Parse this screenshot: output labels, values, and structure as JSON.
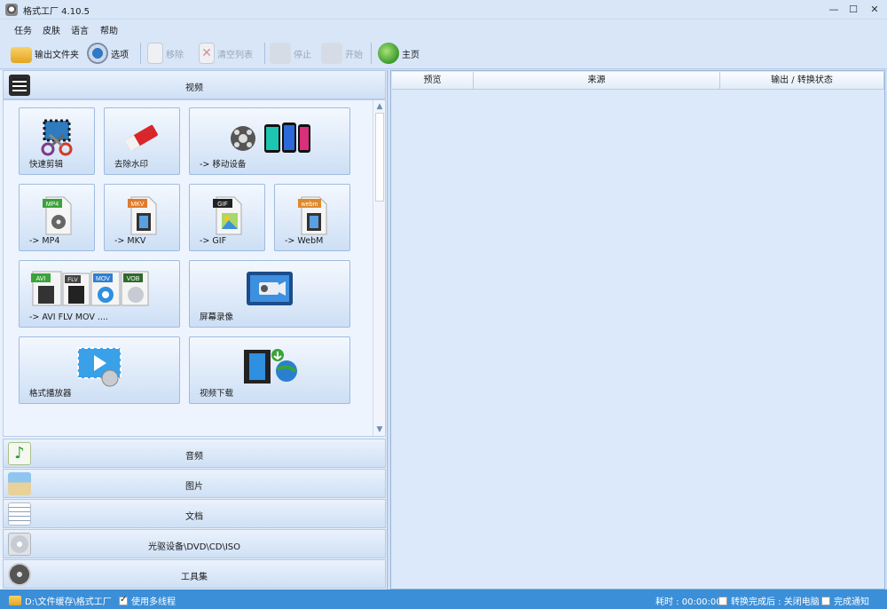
{
  "window": {
    "title": "格式工厂 4.10.5",
    "controls": [
      "—",
      "☐",
      "✕"
    ]
  },
  "menu": [
    "任务",
    "皮肤",
    "语言",
    "帮助"
  ],
  "toolbar": [
    {
      "label": "输出文件夹",
      "icon": "folder-icon",
      "enabled": true
    },
    {
      "label": "选项",
      "icon": "options-gear-icon",
      "enabled": true
    },
    {
      "label": "移除",
      "icon": "remove-icon",
      "enabled": false
    },
    {
      "label": "清空列表",
      "icon": "clear-list-icon",
      "enabled": false
    },
    {
      "label": "停止",
      "icon": "stop-icon",
      "enabled": false
    },
    {
      "label": "开始",
      "icon": "start-icon",
      "enabled": false
    },
    {
      "label": "主页",
      "icon": "home-globe-icon",
      "enabled": true
    }
  ],
  "categories": {
    "video": "视频",
    "audio": "音频",
    "image": "图片",
    "document": "文档",
    "disc": "光驱设备\\DVD\\CD\\ISO",
    "tools": "工具集"
  },
  "video_tiles": [
    {
      "label": "快速剪辑",
      "icon": "quick-clip-icon"
    },
    {
      "label": "去除水印",
      "icon": "remove-watermark-icon"
    },
    {
      "label": "-> 移动设备",
      "icon": "mobile-device-icon"
    },
    {
      "label": "-> MP4",
      "icon": "mp4-file-icon",
      "badge": "MP4"
    },
    {
      "label": "-> MKV",
      "icon": "mkv-file-icon",
      "badge": "MKV"
    },
    {
      "label": "-> GIF",
      "icon": "gif-file-icon",
      "badge": "GIF"
    },
    {
      "label": "-> WebM",
      "icon": "webm-file-icon",
      "badge": "webm"
    },
    {
      "label": "-> AVI FLV MOV ....",
      "icon": "multi-format-icon",
      "badges": [
        "AVI",
        "FLV",
        "MOV",
        "VOB"
      ]
    },
    {
      "label": "屏幕录像",
      "icon": "screen-record-icon"
    },
    {
      "label": "格式播放器",
      "icon": "player-icon"
    },
    {
      "label": "视频下载",
      "icon": "video-download-icon"
    }
  ],
  "table": {
    "columns": [
      "预览",
      "来源",
      "输出 / 转换状态"
    ]
  },
  "status": {
    "folder": "D:\\文件缓存\\格式工厂",
    "multithread_label": "使用多线程",
    "multithread_checked": true,
    "elapsed": "耗时 : 00:00:00",
    "after_done_label": "转换完成后 : 关闭电脑",
    "after_done_checked": false,
    "notify_label": "完成通知",
    "notify_checked": false
  }
}
